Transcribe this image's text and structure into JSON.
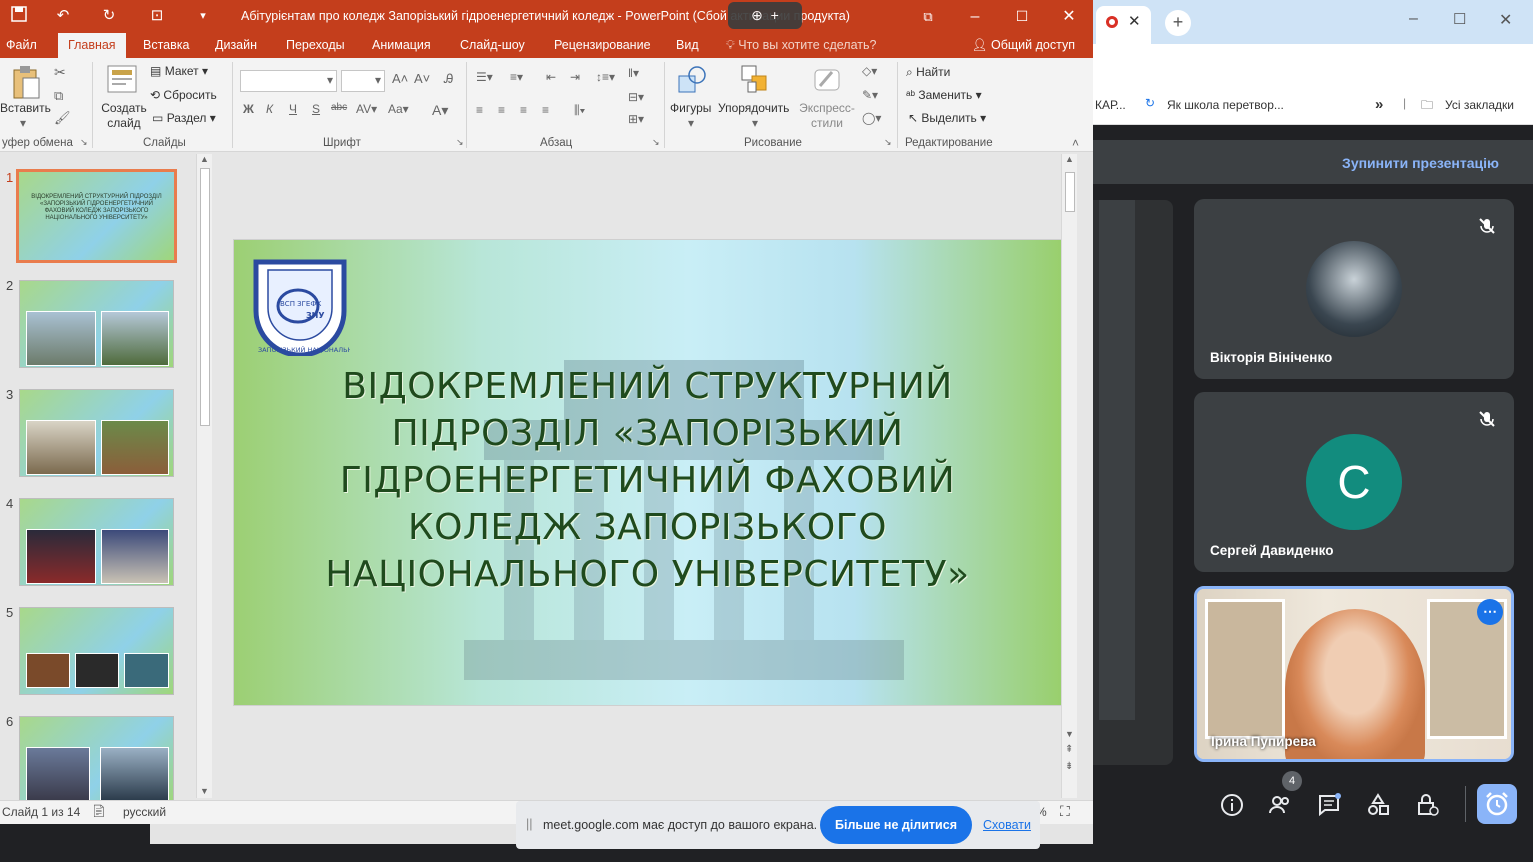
{
  "ppt": {
    "title": "Абітурієнтам про коледж Запорізький гідроенергетичний коледж - PowerPoint (Сбой активации продукта)",
    "tabs": [
      "Файл",
      "Главная",
      "Вставка",
      "Дизайн",
      "Переходы",
      "Анимация",
      "Слайд-шоу",
      "Рецензирование",
      "Вид"
    ],
    "tell_me": "Что вы хотите сделать?",
    "share": "Общий доступ",
    "ribbon": {
      "paste": "Вставить",
      "new_slide": "Создать слайд",
      "layout": "Макет",
      "reset": "Сбросить",
      "section": "Раздел",
      "shapes": "Фигуры",
      "arrange": "Упорядочить",
      "quick_styles": "Экспресс-стили",
      "find": "Найти",
      "replace": "Заменить",
      "select": "Выделить",
      "groups": {
        "clipboard": "уфер обмена",
        "slides": "Слайды",
        "font": "Шрифт",
        "paragraph": "Абзац",
        "drawing": "Рисование",
        "editing": "Редактирование"
      }
    },
    "thumbnails": [
      {
        "n": "1",
        "text": "ВІДОКРЕМЛЕНИЙ СТРУКТУРНИЙ ПІДРОЗДІЛ «ЗАПОРІЗЬКИЙ ГІДРОЕНЕРГЕТИЧНИЙ ФАХОВИЙ КОЛЕДЖ ЗАПОРІЗЬКОГО НАЦІОНАЛЬНОГО УНІВЕРСИТЕТУ»"
      },
      {
        "n": "2"
      },
      {
        "n": "3"
      },
      {
        "n": "4"
      },
      {
        "n": "5"
      },
      {
        "n": "6"
      }
    ],
    "slide": {
      "title": "ВІДОКРЕМЛЕНИЙ СТРУКТУРНИЙ ПІДРОЗДІЛ «ЗАПОРІЗЬКИЙ ГІДРОЕНЕРГЕТИЧНИЙ ФАХОВИЙ КОЛЕДЖ ЗАПОРІЗЬКОГО НАЦІОНАЛЬНОГО УНІВЕРСИТЕТУ»",
      "logo_text": "ЗАПОРІЗЬКИЙ НАЦІОНАЛЬНИЙ УНІВЕРСИТЕТ",
      "logo_abbr": "ЗНУ",
      "logo_vsp": "ВСП ЗГЕФК"
    },
    "status": {
      "slide_of": "Слайд 1 из 14",
      "language": "русский"
    }
  },
  "chrome": {
    "bookmark_truncated": "КАР...",
    "bookmark_1": "Як школа перетвор...",
    "more": "»",
    "all_bookmarks": "Усі закладки"
  },
  "meet": {
    "stop_presenting": "Зупинити презентацію",
    "participants": [
      {
        "name": "Вікторія Вініченко",
        "avatar": "image"
      },
      {
        "name": "Сергей Давиденко",
        "avatar_letter": "С",
        "avatar_color": "#128c7e"
      },
      {
        "name": "Ірина Пупирева",
        "video": true
      }
    ],
    "people_count": "4",
    "notice_text": "meet.google.com має доступ до вашого екрана.",
    "stop_sharing": "Більше не ділитися",
    "hide": "Сховати"
  },
  "colors": {
    "ppt_accent": "#c43e1c",
    "meet_bg": "#202124",
    "meet_link": "#8ab4f8",
    "google_blue": "#1a73e8"
  }
}
